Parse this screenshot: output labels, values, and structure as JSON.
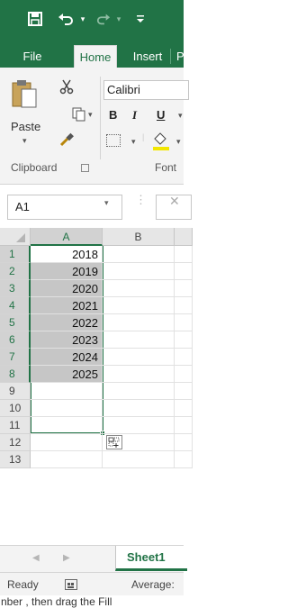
{
  "colors": {
    "accent": "#217346",
    "selection_fill": "#c6c6c6",
    "ribbon_bg": "#f3f3f3"
  },
  "qat": {
    "save_icon": "save-icon",
    "undo_icon": "undo-icon",
    "redo_icon": "redo-icon",
    "customize_icon": "customize-qat-icon"
  },
  "ribbon_tabs": [
    "File",
    "Home",
    "Insert",
    "P"
  ],
  "active_tab": "Home",
  "clipboard": {
    "paste_label": "Paste",
    "group_label": "Clipboard"
  },
  "font": {
    "name": "Calibri",
    "bold": "B",
    "italic": "I",
    "underline": "U",
    "group_label": "Font"
  },
  "formula_bar": {
    "name_box": "A1",
    "dots": "⋮",
    "cancel": "✕"
  },
  "columns": [
    "A",
    "B"
  ],
  "rows": [
    "1",
    "2",
    "3",
    "4",
    "5",
    "6",
    "7",
    "8",
    "9",
    "10",
    "11",
    "12",
    "13"
  ],
  "cells_a": [
    "2018",
    "2019",
    "2020",
    "2021",
    "2022",
    "2023",
    "2024",
    "2025",
    "",
    "",
    "",
    "",
    ""
  ],
  "sheet_tab": "Sheet1",
  "status": {
    "ready": "Ready",
    "average": "Average:"
  },
  "caption": "nber , then drag the Fill"
}
